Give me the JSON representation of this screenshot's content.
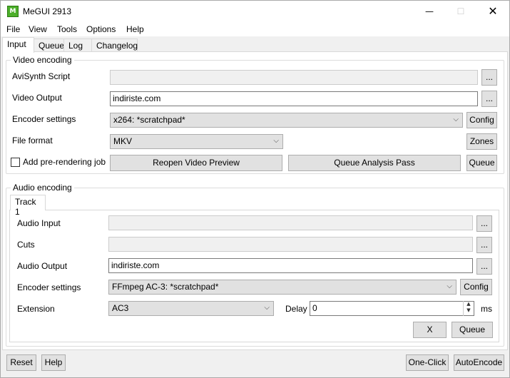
{
  "window": {
    "title": "MeGUI 2913",
    "icon_text": "M"
  },
  "menu": [
    "File",
    "View",
    "Tools",
    "Options",
    "Help"
  ],
  "tabs": [
    "Input",
    "Queue",
    "Log",
    "Changelog"
  ],
  "video": {
    "group_title": "Video encoding",
    "avisynth_label": "AviSynth Script",
    "avisynth_value": "",
    "output_label": "Video Output",
    "output_value": "indiriste.com",
    "encoder_label": "Encoder settings",
    "encoder_value": "x264: *scratchpad*",
    "config_label": "Config",
    "format_label": "File format",
    "format_value": "MKV",
    "zones_label": "Zones",
    "prerender_label": "Add pre-rendering job",
    "reopen_label": "Reopen Video Preview",
    "analysis_label": "Queue Analysis Pass",
    "queue_label": "Queue",
    "browse_label": "..."
  },
  "audio": {
    "group_title": "Audio encoding",
    "track_tab": "Track 1",
    "input_label": "Audio Input",
    "input_value": "",
    "cuts_label": "Cuts",
    "cuts_value": "",
    "output_label": "Audio Output",
    "output_value": "indiriste.com",
    "encoder_label": "Encoder settings",
    "encoder_value": "FFmpeg AC-3: *scratchpad*",
    "config_label": "Config",
    "extension_label": "Extension",
    "extension_value": "AC3",
    "delay_label": "Delay",
    "delay_value": "0",
    "delay_unit": "ms",
    "x_label": "X",
    "queue_label": "Queue",
    "browse_label": "..."
  },
  "bottom": {
    "reset": "Reset",
    "help": "Help",
    "oneclick": "One-Click",
    "autoencode": "AutoEncode"
  }
}
